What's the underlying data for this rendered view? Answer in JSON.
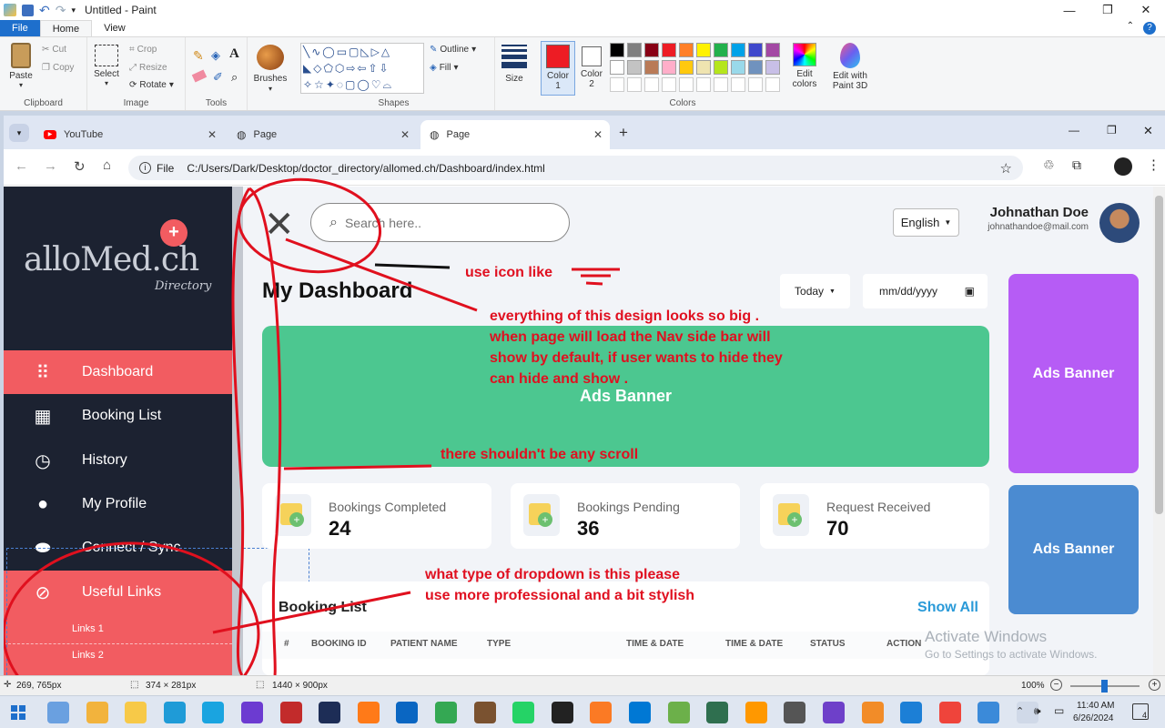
{
  "paint": {
    "title": "Untitled - Paint",
    "tabs": [
      "File",
      "Home",
      "View"
    ],
    "clipboard": {
      "paste": "Paste",
      "cut": "Cut",
      "copy": "Copy",
      "label": "Clipboard"
    },
    "image": {
      "select": "Select",
      "crop": "Crop",
      "resize": "Resize",
      "rotate": "Rotate",
      "label": "Image"
    },
    "tools": {
      "label": "Tools"
    },
    "brushes": "Brushes",
    "shapes": {
      "label": "Shapes",
      "outline": "Outline",
      "fill": "Fill"
    },
    "size": "Size",
    "color1": "Color 1",
    "color2": "Color 2",
    "colors_label": "Colors",
    "edit_colors": "Edit colors",
    "paint3d": "Edit with Paint 3D",
    "palette": [
      "#000000",
      "#7f7f7f",
      "#880015",
      "#ed1c24",
      "#ff7f27",
      "#fff200",
      "#22b14c",
      "#00a2e8",
      "#3f48cc",
      "#a349a4",
      "#ffffff",
      "#c3c3c3",
      "#b97a57",
      "#ffaec9",
      "#ffc90e",
      "#efe4b0",
      "#b5e61d",
      "#99d9ea",
      "#7092be",
      "#c8bfe7"
    ],
    "color1_value": "#ed1c24",
    "status": {
      "pos": "269, 765px",
      "sel": "374 × 281px",
      "canvas": "1440 × 900px",
      "zoom": "100%"
    }
  },
  "browser": {
    "tabs": [
      {
        "title": "YouTube"
      },
      {
        "title": "Page"
      },
      {
        "title": "Page"
      }
    ],
    "url_label": "File",
    "url": "C:/Users/Dark/Desktop/doctor_directory/allomed.ch/Dashboard/index.html"
  },
  "site": {
    "logo_main": "alloMed.ch",
    "logo_sub": "Directory",
    "nav": [
      {
        "label": "Dashboard",
        "icon": "grid-icon",
        "active": true
      },
      {
        "label": "Booking List",
        "icon": "calendar-icon",
        "active": false
      },
      {
        "label": "History",
        "icon": "clock-icon",
        "active": false
      },
      {
        "label": "My Profile",
        "icon": "user-icon",
        "active": false
      },
      {
        "label": "Connect / Sync",
        "icon": "link-icon",
        "active": false
      },
      {
        "label": "Useful Links",
        "icon": "chain-icon",
        "active": true
      }
    ],
    "sub_links": [
      "Links 1",
      "Links 2"
    ],
    "search_placeholder": "Search here..",
    "language": "English",
    "user_name": "Johnathan Doe",
    "user_email": "johnathandoe@mail.com",
    "page_title": "My Dashboard",
    "filter_today": "Today",
    "date_placeholder": "mm/dd/yyyy",
    "banner_main": "Ads Banner",
    "side_banner_1": "Ads Banner",
    "side_banner_2": "Ads Banner",
    "stats": [
      {
        "label": "Bookings Completed",
        "value": "24"
      },
      {
        "label": "Bookings Pending",
        "value": "36"
      },
      {
        "label": "Request Received",
        "value": "70"
      }
    ],
    "booking_title": "Booking List",
    "show_all": "Show All",
    "table_headers": [
      "#",
      "BOOKING ID",
      "PATIENT NAME",
      "TYPE",
      "TIME & DATE",
      "TIME & DATE",
      "STATUS",
      "ACTION"
    ],
    "colors": {
      "sidebar": "#1c2231",
      "accent": "#f25c61",
      "green": "#4cc790",
      "purple": "#b65cf5",
      "blue": "#4b8bd1"
    }
  },
  "annotations": [
    "use icon like",
    "everything of this design looks so big . when page will load the Nav side bar will show by default, if user wants to hide they can hide and show .",
    "there shouldn't be any scroll",
    "what type of dropdown is this please use more professional and a bit stylish"
  ],
  "watermark": {
    "line1": "Activate Windows",
    "line2": "Go to Settings to activate Windows."
  },
  "taskbar": {
    "time": "11:40 AM",
    "date": "6/26/2024",
    "notif": "4"
  }
}
